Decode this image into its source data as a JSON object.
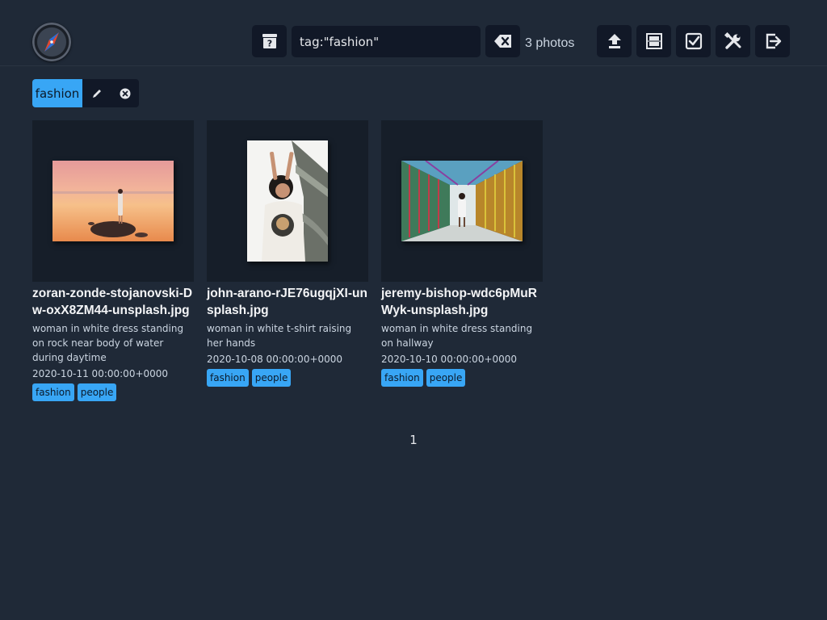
{
  "search": {
    "value": "tag:\"fashion\""
  },
  "count_label": "3 photos",
  "active_tag": {
    "label": "fashion"
  },
  "photos": [
    {
      "filename": "zoran-zonde-stojanovski-Dw-oxX8ZM44-unsplash.jpg",
      "description": "woman in white dress standing on rock near body of water during daytime",
      "date": "2020-10-11 00:00:00+0000",
      "tags": [
        "fashion",
        "people"
      ]
    },
    {
      "filename": "john-arano-rJE76ugqjXI-unsplash.jpg",
      "description": "woman in white t-shirt raising her hands",
      "date": "2020-10-08 00:00:00+0000",
      "tags": [
        "fashion",
        "people"
      ]
    },
    {
      "filename": "jeremy-bishop-wdc6pMuRWyk-unsplash.jpg",
      "description": "woman in white dress standing on hallway",
      "date": "2020-10-10 00:00:00+0000",
      "tags": [
        "fashion",
        "people"
      ]
    }
  ],
  "pagination": {
    "current": "1"
  },
  "colors": {
    "accent": "#38a6f5",
    "background": "#1f2937",
    "panel": "#111827"
  }
}
